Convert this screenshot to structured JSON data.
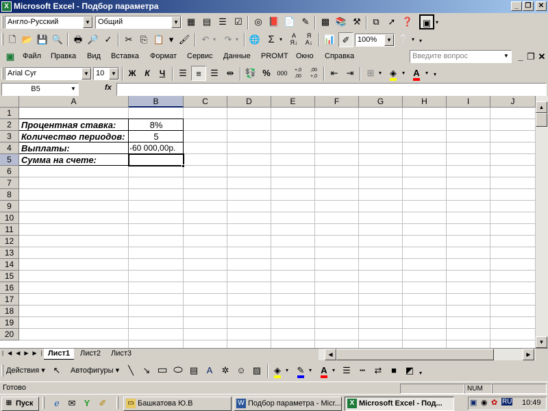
{
  "window": {
    "title": "Microsoft Excel - Подбор параметра"
  },
  "toolbar1": {
    "translate_dir": "Англо-Русский",
    "style": "Общий"
  },
  "toolbar2": {
    "zoom": "100%"
  },
  "menu": {
    "items": [
      "Файл",
      "Правка",
      "Вид",
      "Вставка",
      "Формат",
      "Сервис",
      "Данные",
      "PROMT",
      "Окно",
      "Справка"
    ],
    "help_placeholder": "Введите вопрос"
  },
  "format": {
    "font": "Arial Cyr",
    "size": "10",
    "bold": "Ж",
    "italic": "К",
    "underline": "Ч",
    "percent": "%",
    "thousands": "000",
    "inc_decimal": "+,0\n,00",
    "dec_decimal": ",00\n+,0"
  },
  "formula": {
    "cell_ref": "B5",
    "fx": "fx",
    "content": ""
  },
  "sheet": {
    "columns": [
      "A",
      "B",
      "C",
      "D",
      "E",
      "F",
      "G",
      "H",
      "I",
      "J"
    ],
    "rows": [
      "1",
      "2",
      "3",
      "4",
      "5",
      "6",
      "7",
      "8",
      "9",
      "10",
      "11",
      "12",
      "13",
      "14",
      "15",
      "16",
      "17",
      "18",
      "19",
      "20"
    ],
    "selected_cell": "B5",
    "cells": {
      "A2": "Процентная ставка:",
      "B2": "8%",
      "A3": "Количество периодов:",
      "B3": "5",
      "A4": "Выплаты:",
      "B4": "-60 000,00р.",
      "A5": "Сумма на счете:",
      "B5": ""
    }
  },
  "tabs": [
    "Лист1",
    "Лист2",
    "Лист3"
  ],
  "active_tab": "Лист1",
  "drawing": {
    "actions": "Действия",
    "autoshapes": "Автофигуры"
  },
  "status": {
    "ready": "Готово",
    "num": "NUM"
  },
  "taskbar": {
    "start": "Пуск",
    "items": [
      {
        "label": "Башкатова Ю.В",
        "icon": "folder-icon"
      },
      {
        "label": "Подбор параметра - Micr...",
        "icon": "word-icon"
      },
      {
        "label": "Microsoft Excel - Под...",
        "icon": "excel-icon",
        "active": true
      }
    ],
    "lang": "RU",
    "time": "10:49"
  },
  "colors": {
    "title_start": "#0a246a",
    "title_end": "#a6caf0",
    "selection": "#b6bdd2",
    "excel_green": "#1e7b3a"
  }
}
